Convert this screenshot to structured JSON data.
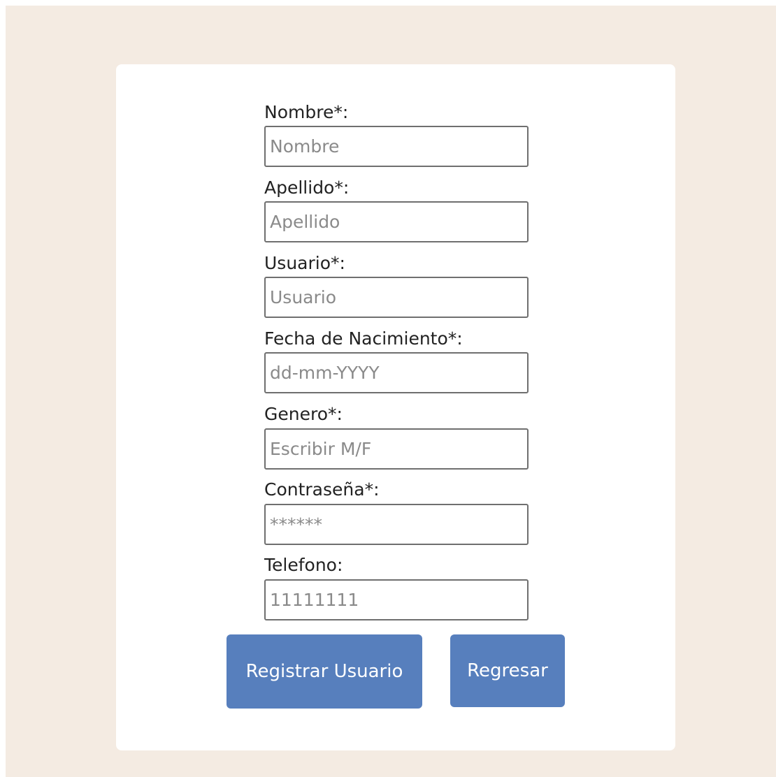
{
  "form": {
    "nombre": {
      "label": "Nombre*:",
      "placeholder": "Nombre"
    },
    "apellido": {
      "label": "Apellido*:",
      "placeholder": "Apellido"
    },
    "usuario": {
      "label": "Usuario*:",
      "placeholder": "Usuario"
    },
    "fecha_nacimiento": {
      "label": "Fecha de Nacimiento*:",
      "placeholder": "dd-mm-YYYY"
    },
    "genero": {
      "label": "Genero*:",
      "placeholder": "Escribir M/F"
    },
    "contrasena": {
      "label": "Contraseña*:",
      "placeholder": "******"
    },
    "telefono": {
      "label": "Telefono:",
      "placeholder": "11111111"
    }
  },
  "actions": {
    "register_label": "Registrar Usuario",
    "back_label": "Regresar"
  },
  "colors": {
    "page_background": "#f4ebe2",
    "card_background": "#ffffff",
    "button_primary": "#577fbd"
  }
}
